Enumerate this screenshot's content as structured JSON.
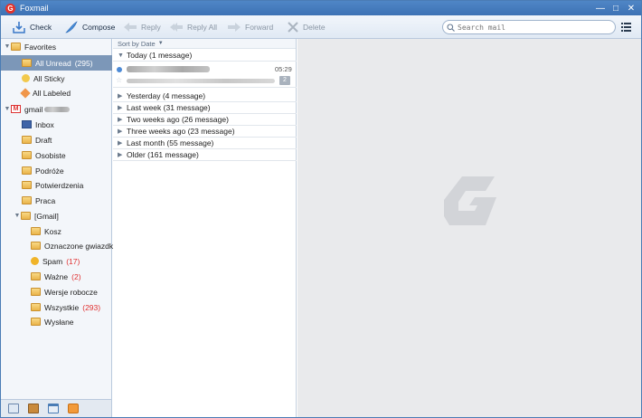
{
  "app": {
    "title": "Foxmail",
    "logo_letter": "G"
  },
  "window_controls": {
    "minimize": "—",
    "maximize": "□",
    "close": "✕"
  },
  "toolbar": {
    "check": "Check",
    "compose": "Compose",
    "reply": "Reply",
    "reply_all": "Reply All",
    "forward": "Forward",
    "delete": "Delete"
  },
  "search": {
    "placeholder": "Search mail"
  },
  "sidebar": {
    "favorites": "Favorites",
    "all_unread": {
      "label": "All Unread",
      "count": "(295)"
    },
    "all_sticky": "All Sticky",
    "all_labeled": "All Labeled",
    "account": "gmail",
    "folders": [
      {
        "label": "Inbox"
      },
      {
        "label": "Draft"
      },
      {
        "label": "Osobiste"
      },
      {
        "label": "Podróże"
      },
      {
        "label": "Potwierdzenia"
      },
      {
        "label": "Praca"
      }
    ],
    "gmail_group": "[Gmail]",
    "gmail_folders": [
      {
        "label": "Kosz",
        "count": ""
      },
      {
        "label": "Oznaczone gwiazdką",
        "count": ""
      },
      {
        "label": "Spam",
        "count": "(17)"
      },
      {
        "label": "Ważne",
        "count": "(2)"
      },
      {
        "label": "Wersje robocze",
        "count": ""
      },
      {
        "label": "Wszystkie",
        "count": "(293)"
      },
      {
        "label": "Wysłane",
        "count": ""
      }
    ]
  },
  "list": {
    "sort_label": "Sort by Date",
    "groups": [
      {
        "label": "Today (1 message)"
      },
      {
        "label": "Yesterday (4 message)"
      },
      {
        "label": "Last week (31 message)"
      },
      {
        "label": "Two weeks ago (26 message)"
      },
      {
        "label": "Three weeks ago (23 message)"
      },
      {
        "label": "Last month (55 message)"
      },
      {
        "label": "Older (161 message)"
      }
    ],
    "today_message": {
      "time": "05:29",
      "attachments": "2"
    }
  },
  "colors": {
    "accent": "#4a7cb5",
    "selected_row": "#7c97b8",
    "count_red": "#e03030"
  }
}
